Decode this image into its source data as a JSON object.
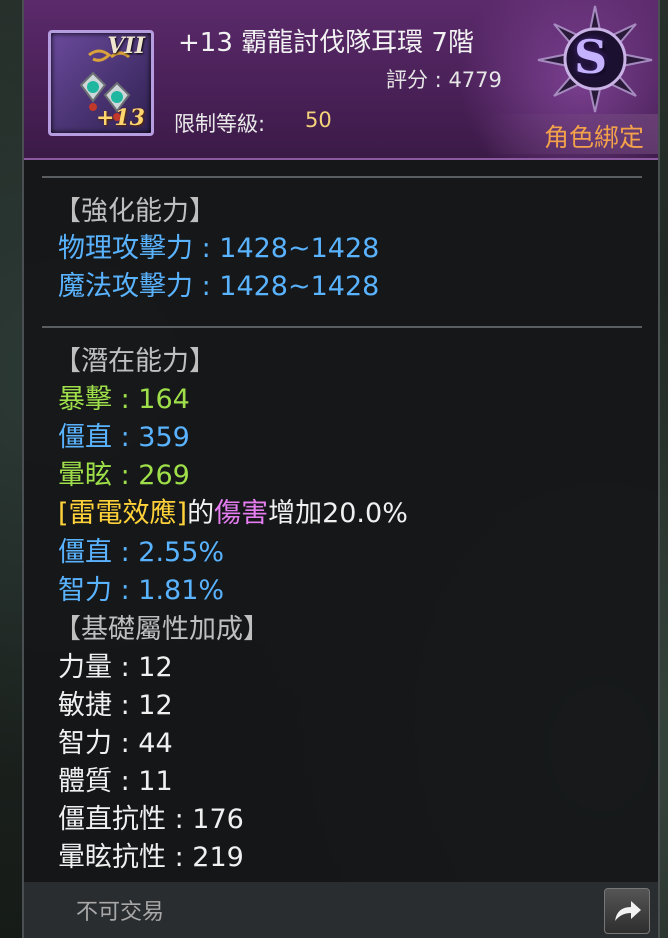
{
  "item": {
    "title": "+13 霸龍討伐隊耳環 7階",
    "score_label": "評分 : ",
    "score_value": "4779",
    "level_label": "限制等級:",
    "level_value": "50",
    "bound": "角色綁定",
    "rank": "S",
    "icon_grade": "VII",
    "icon_plus": "+13",
    "icon": "earring-icon"
  },
  "enhance": {
    "header": "【強化能力】",
    "lines": [
      "物理攻擊力 : 1428~1428",
      "魔法攻擊力 : 1428~1428"
    ]
  },
  "potential": {
    "header": "【潛在能力】",
    "lines": [
      {
        "text": "暴擊 : 164",
        "color": "#9fe04a"
      },
      {
        "text": "僵直 : 359",
        "color": "#5ab3ff"
      },
      {
        "text": "暈眩 : 269",
        "color": "#9fe04a"
      }
    ],
    "effect": {
      "skill": "[雷電效應]",
      "mid": "的",
      "dmg": "傷害",
      "tail": "增加20.0%"
    },
    "lines2": [
      {
        "text": "僵直 : 2.55%",
        "color": "#5ab3ff"
      },
      {
        "text": "智力 : 1.81%",
        "color": "#5ab3ff"
      }
    ]
  },
  "base": {
    "header": "【基礎屬性加成】",
    "lines": [
      "力量 : 12",
      "敏捷 : 12",
      "智力 : 44",
      "體質 : 11",
      "僵直抗性 : 176",
      "暈眩抗性 : 219"
    ]
  },
  "footer": {
    "trade": "不可交易",
    "share_icon": "share-arrow-icon"
  }
}
